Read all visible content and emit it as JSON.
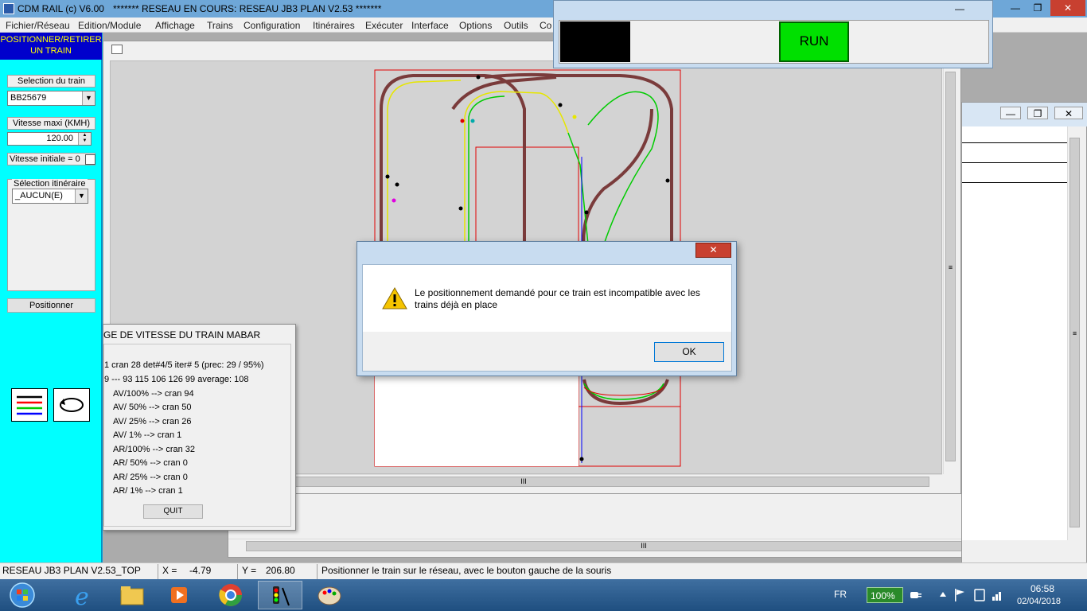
{
  "window": {
    "app_title": "CDM RAIL (c) V6.00",
    "doc_title": "******* RESEAU EN COURS: RESEAU JB3 PLAN   V2.53 *******",
    "minimize": "—",
    "maximize": "❐",
    "close": "✕"
  },
  "menu": {
    "items": [
      "Fichier/Réseau",
      "Edition/Module",
      "Affichage",
      "Trains",
      "Configuration",
      "Itinéraires",
      "Exécuter",
      "Interface",
      "Options",
      "Outils",
      "Co"
    ]
  },
  "left_panel": {
    "header": "POSITIONNER/RETIRER UN TRAIN",
    "train_label": "Selection du train",
    "train_value": "BB25679",
    "speed_label": "Vitesse maxi (KMH)",
    "speed_value": "120.00",
    "initial_speed_label": "Vitesse initiale = 0",
    "route_label": "Sélection itinéraire",
    "route_value": "_AUCUN(E)",
    "position_button": "Positionner"
  },
  "run_window": {
    "run_label": "RUN"
  },
  "speed_window": {
    "title": "GE DE VITESSE DU TRAIN MABAR",
    "line1": "1 cran  28 det#4/5 iter# 5 (prec:  29 /  95%)",
    "line2": "9 --- 93 115 106 126 99 average: 108",
    "rows": [
      "AV/100% --> cran  94",
      "AV/ 50% --> cran  50",
      "AV/ 25% --> cran  26",
      "AV/  1% --> cran   1",
      "AR/100% --> cran  32",
      "AR/ 50% --> cran   0",
      "AR/ 25% --> cran   0",
      "AR/  1% --> cran   1"
    ],
    "quit_button": "QUIT"
  },
  "dialog": {
    "message": "Le positionnement demandé pour ce train est incompatible avec les trains déjà en place",
    "ok_button": "OK",
    "close": "✕"
  },
  "scroll": {
    "grip": "III",
    "grip_v": "≡"
  },
  "statusbar": {
    "network": "RESEAU JB3 PLAN   V2.53_TOP",
    "x_label": "X =",
    "x_value": "-4.79",
    "y_label": "Y =",
    "y_value": "206.80",
    "hint": "Positionner le train sur le réseau, avec le bouton gauche de la souris"
  },
  "taskbar": {
    "language": "FR",
    "battery": "100%",
    "time": "06:58",
    "date": "02/04/2018"
  },
  "colors": {
    "track": "#7a3b3b",
    "track_green": "#00cc00",
    "track_yellow": "#e6e600",
    "accent_cyan": "#00ffff",
    "run_green": "#00e000"
  }
}
